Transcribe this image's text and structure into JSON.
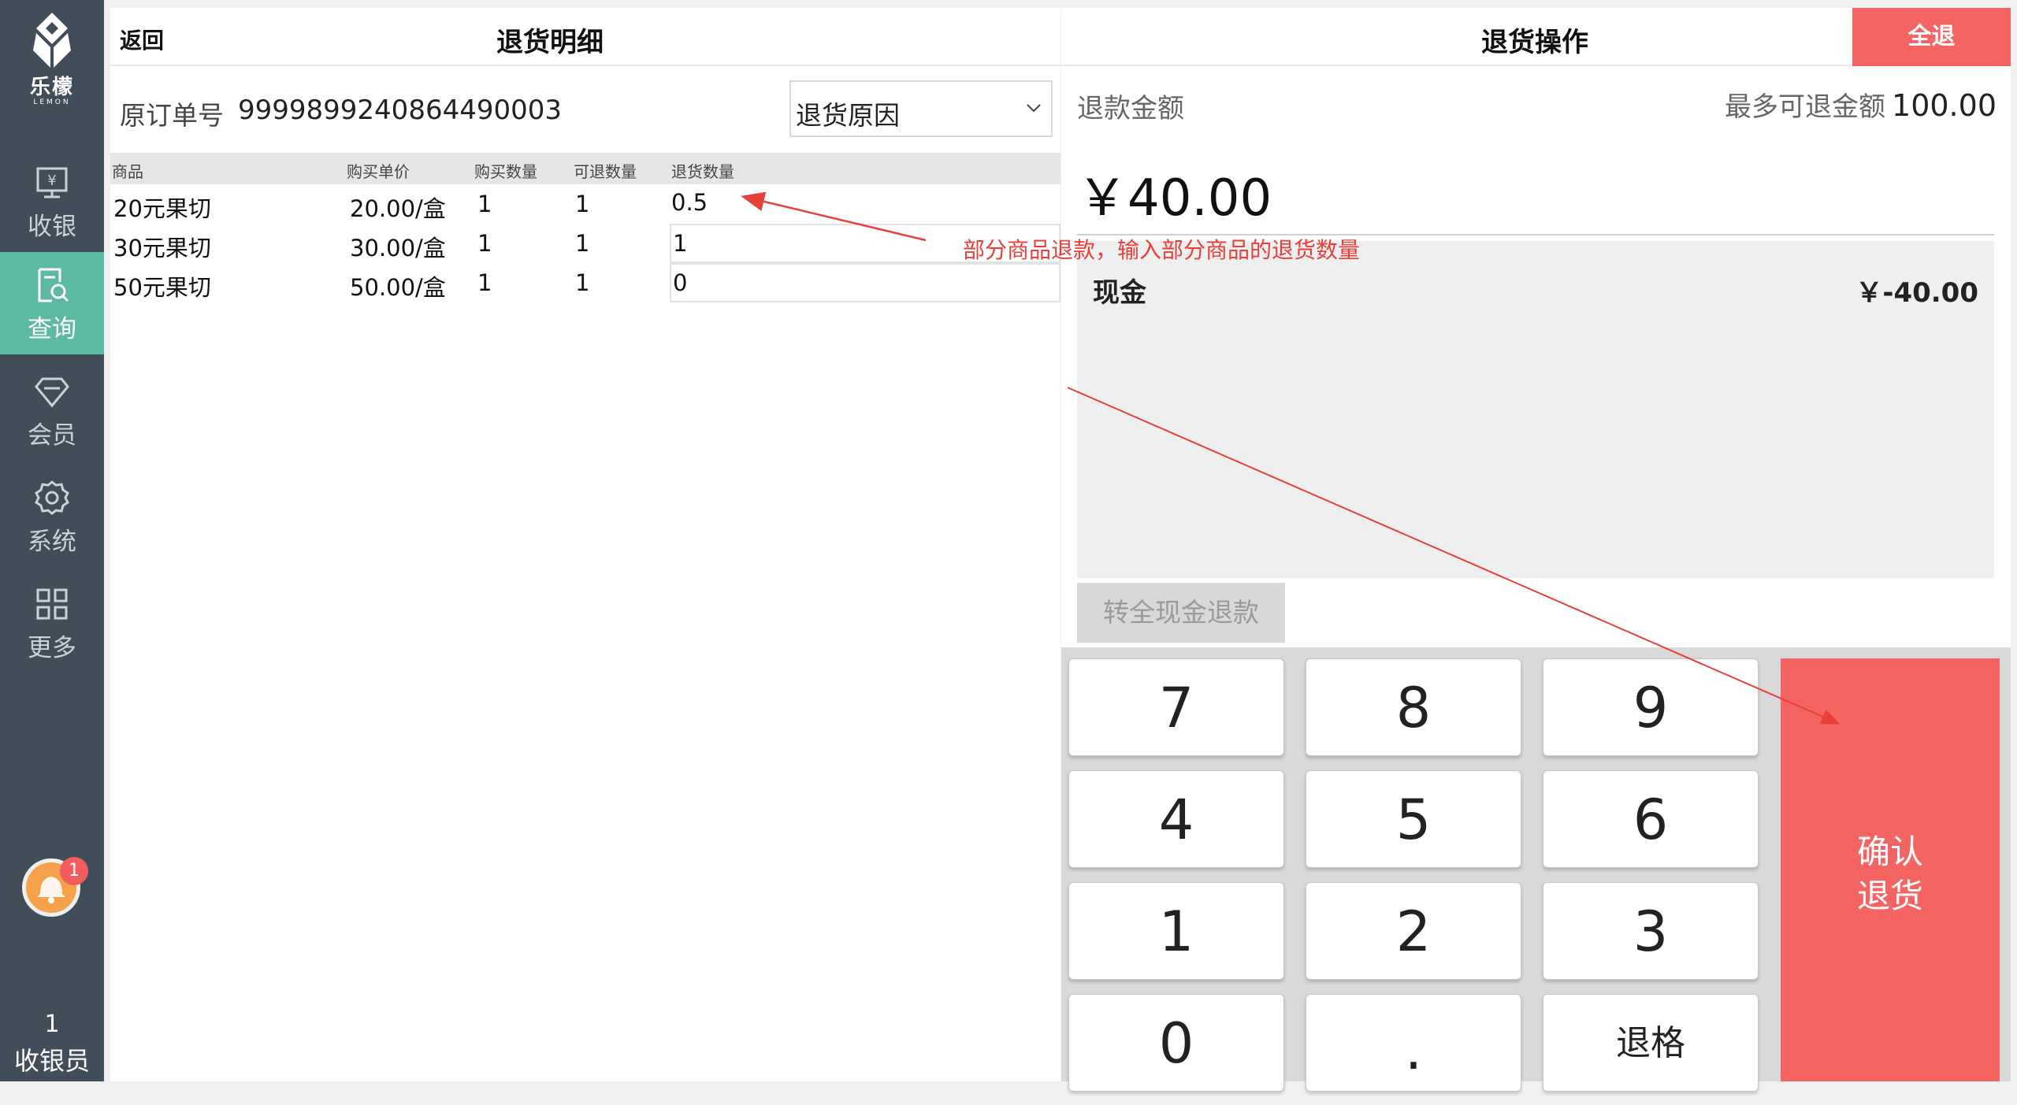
{
  "sidebar": {
    "logo_text": "乐檬",
    "logo_sub": "LEMON",
    "items": [
      {
        "label": "收银",
        "icon": "cashier-monitor-icon"
      },
      {
        "label": "查询",
        "icon": "query-document-icon",
        "active": true
      },
      {
        "label": "会员",
        "icon": "member-diamond-icon"
      },
      {
        "label": "系统",
        "icon": "settings-gear-icon"
      },
      {
        "label": "更多",
        "icon": "more-grid-icon"
      }
    ],
    "notification_count": "1",
    "cashier_number": "1",
    "cashier_label": "收银员"
  },
  "detail": {
    "back_label": "返回",
    "title": "退货明细",
    "order_label": "原订单号",
    "order_number": "9999899240864490003",
    "reason_placeholder": "退货原因",
    "columns": [
      "商品",
      "购买单价",
      "购买数量",
      "可退数量",
      "退货数量"
    ],
    "rows": [
      {
        "product": "20元果切",
        "price": "20.00/盒",
        "bought": "1",
        "returnable": "1",
        "return_qty": "0.5"
      },
      {
        "product": "30元果切",
        "price": "30.00/盒",
        "bought": "1",
        "returnable": "1",
        "return_qty": "1"
      },
      {
        "product": "50元果切",
        "price": "50.00/盒",
        "bought": "1",
        "returnable": "1",
        "return_qty": "0"
      }
    ]
  },
  "operation": {
    "title": "退货操作",
    "all_return_label": "全退",
    "refund_label": "退款金额",
    "max_label": "最多可退金额",
    "max_value": "100.00",
    "refund_amount": "￥40.00",
    "pay_method": "现金",
    "pay_value": "￥-40.00",
    "cash_button": "转全现金退款",
    "keys": [
      "7",
      "8",
      "9",
      "4",
      "5",
      "6",
      "1",
      "2",
      "3",
      "0",
      ".",
      "退格"
    ],
    "confirm_line1": "确认",
    "confirm_line2": "退货"
  },
  "annotation": {
    "text": "部分商品退款，输入部分商品的退货数量",
    "color": "#e8403a"
  },
  "colors": {
    "sidebar_bg": "#414d59",
    "active_nav": "#5cb9a4",
    "accent_red": "#f36462"
  }
}
